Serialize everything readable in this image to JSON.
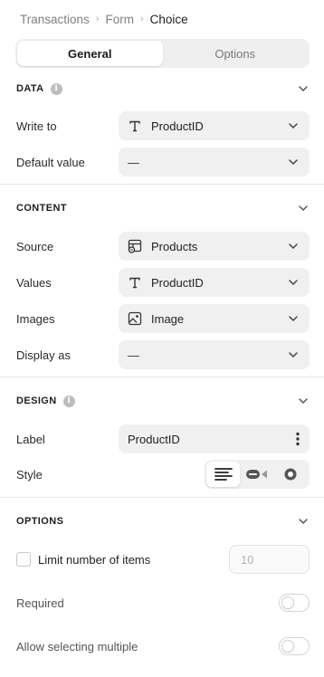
{
  "breadcrumb": {
    "items": [
      "Transactions",
      "Form",
      "Choice"
    ],
    "separator": "›"
  },
  "tabs": [
    {
      "label": "General",
      "active": true
    },
    {
      "label": "Options",
      "active": false
    }
  ],
  "sections": {
    "data": {
      "title": "DATA",
      "info": "i",
      "write_to": {
        "label": "Write to",
        "icon": "text-type-icon",
        "value": "ProductID"
      },
      "default_value": {
        "label": "Default value",
        "value": "—"
      }
    },
    "content": {
      "title": "CONTENT",
      "source": {
        "label": "Source",
        "icon": "table-source-icon",
        "value": "Products"
      },
      "values": {
        "label": "Values",
        "icon": "text-type-icon",
        "value": "ProductID"
      },
      "images": {
        "label": "Images",
        "icon": "image-icon",
        "value": "Image"
      },
      "display_as": {
        "label": "Display as",
        "value": "—"
      }
    },
    "design": {
      "title": "DESIGN",
      "info": "i",
      "label": {
        "label": "Label",
        "value": "ProductID",
        "menu_icon": "more-vertical-icon"
      },
      "style": {
        "label": "Style",
        "options": [
          "list-style-icon",
          "toggle-style-icon",
          "radio-style-icon"
        ],
        "selected": 0
      }
    },
    "options": {
      "title": "OPTIONS",
      "limit": {
        "label": "Limit number of items",
        "checked": false,
        "placeholder": "10"
      },
      "required": {
        "label": "Required",
        "on": false
      },
      "allow_multiple": {
        "label": "Allow selecting multiple",
        "on": false
      }
    }
  }
}
